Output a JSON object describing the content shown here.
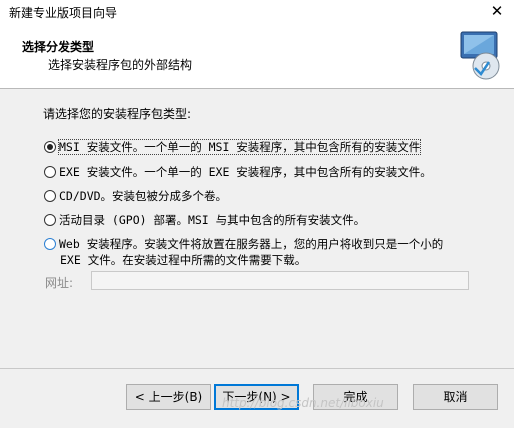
{
  "window": {
    "title": "新建专业版项目向导",
    "close_glyph": "✕"
  },
  "header": {
    "title": "选择分发类型",
    "subtitle": "选择安装程序包的外部结构"
  },
  "prompt": "请选择您的安装程序包类型:",
  "options": [
    {
      "label": "MSI 安装文件。一个单一的 MSI 安装程序，其中包含所有的安装文件",
      "checked": true
    },
    {
      "label": "EXE 安装文件。一个单一的 EXE 安装程序，其中包含所有的安装文件。",
      "checked": false
    },
    {
      "label": "CD/DVD。安装包被分成多个卷。",
      "checked": false
    },
    {
      "label": "活动目录 (GPO) 部署。MSI 与其中包含的所有安装文件。",
      "checked": false
    },
    {
      "label": "Web 安装程序。安装文件将放置在服务器上，您的用户将收到只是一个小的",
      "label_line2": "EXE 文件。在安装过程中所需的文件需要下载。",
      "checked": false
    }
  ],
  "url": {
    "label": "网址:",
    "value": ""
  },
  "buttons": {
    "back": "< 上一步(B)",
    "next": "下一步(N) >",
    "finish": "完成",
    "cancel": "取消"
  },
  "watermark": "http://blog.csdn.net/liboxiu"
}
